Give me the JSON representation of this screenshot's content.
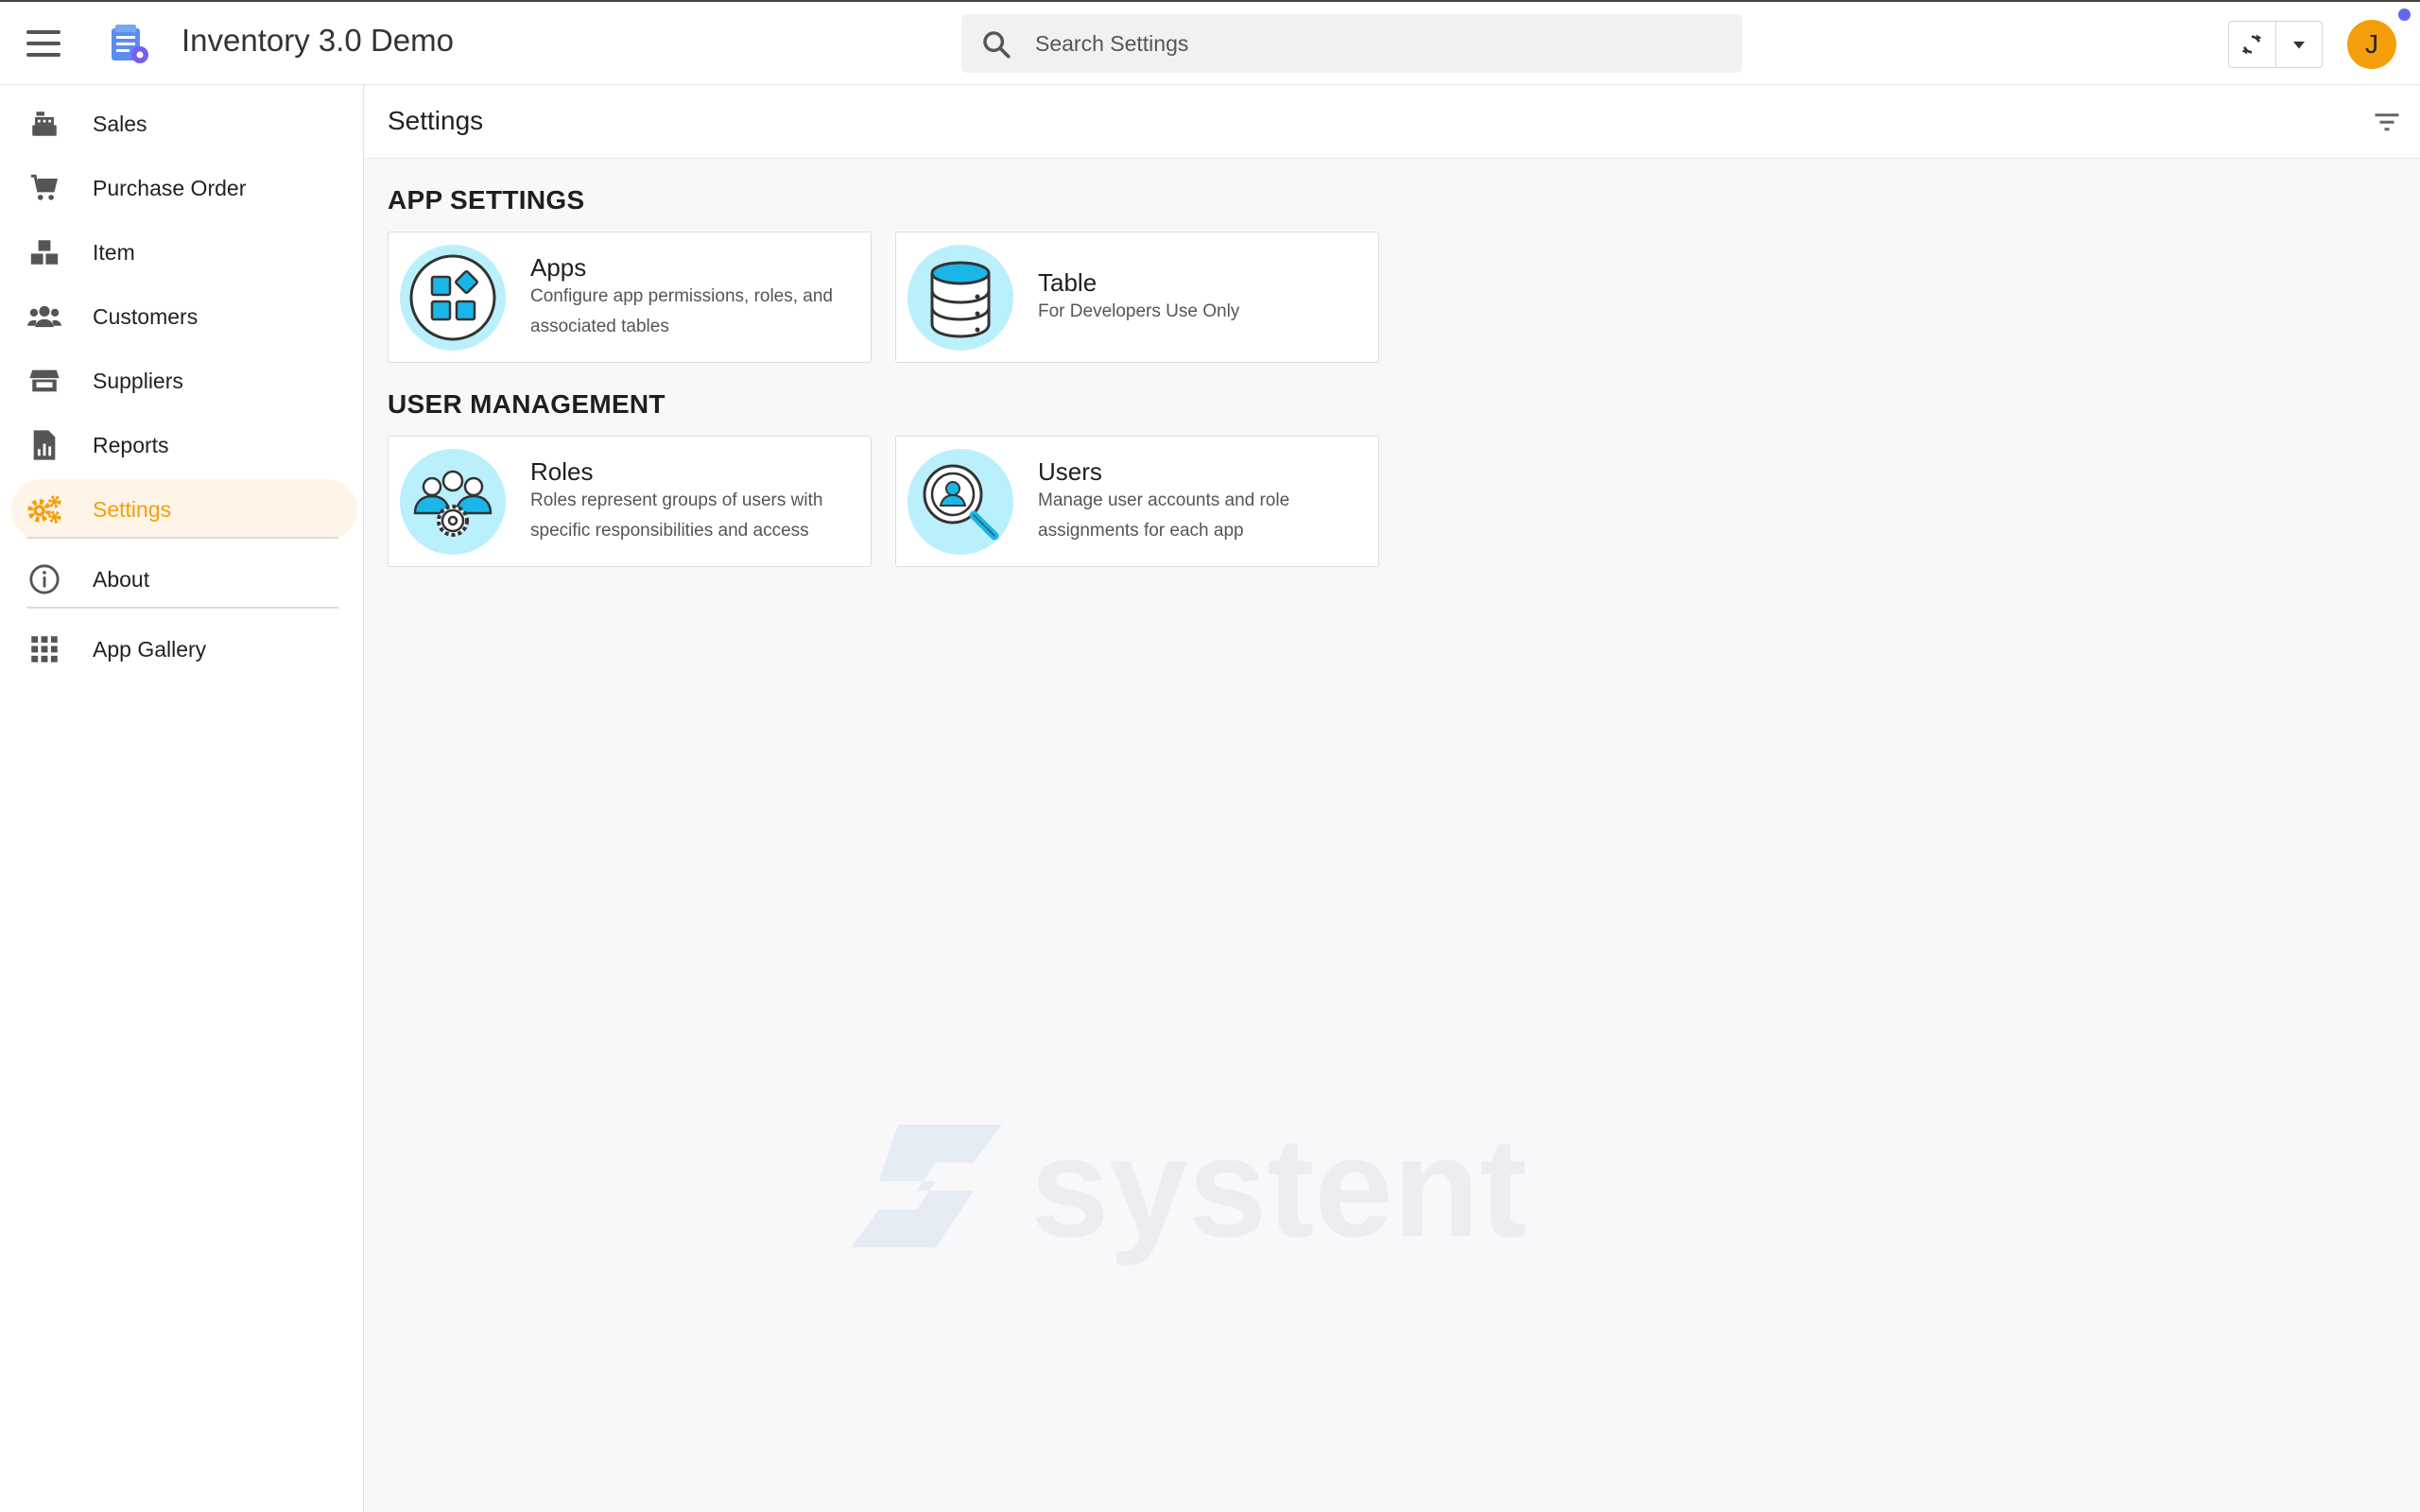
{
  "app": {
    "title": "Inventory 3.0 Demo"
  },
  "search": {
    "placeholder": "Search Settings"
  },
  "user": {
    "initial": "J"
  },
  "sidebar": {
    "items": [
      {
        "label": "Sales",
        "icon": "cash-register-icon"
      },
      {
        "label": "Purchase Order",
        "icon": "cart-icon"
      },
      {
        "label": "Item",
        "icon": "boxes-icon"
      },
      {
        "label": "Customers",
        "icon": "users-icon"
      },
      {
        "label": "Suppliers",
        "icon": "store-icon"
      },
      {
        "label": "Reports",
        "icon": "report-icon"
      },
      {
        "label": "Settings",
        "icon": "gears-icon",
        "active": true
      },
      {
        "label": "About",
        "icon": "info-icon"
      },
      {
        "label": "App Gallery",
        "icon": "grid-icon"
      }
    ]
  },
  "main": {
    "title": "Settings",
    "sections": [
      {
        "title": "APP SETTINGS",
        "cards": [
          {
            "title": "Apps",
            "description": "Configure app permissions, roles, and associated tables",
            "icon": "apps-icon"
          },
          {
            "title": "Table",
            "description": "For Developers Use Only",
            "icon": "database-icon"
          }
        ]
      },
      {
        "title": "USER MANAGEMENT",
        "cards": [
          {
            "title": "Roles",
            "description": "Roles represent groups of users with specific responsibilities and access",
            "icon": "roles-icon"
          },
          {
            "title": "Users",
            "description": "Manage user accounts and role assignments for each app",
            "icon": "user-search-icon"
          }
        ]
      }
    ]
  },
  "watermark": {
    "text": "systent"
  },
  "colors": {
    "accent": "#f59e0b",
    "active_bg": "#fff4e8",
    "icon_circle": "#b9f0fb",
    "notify": "#6366f1"
  }
}
